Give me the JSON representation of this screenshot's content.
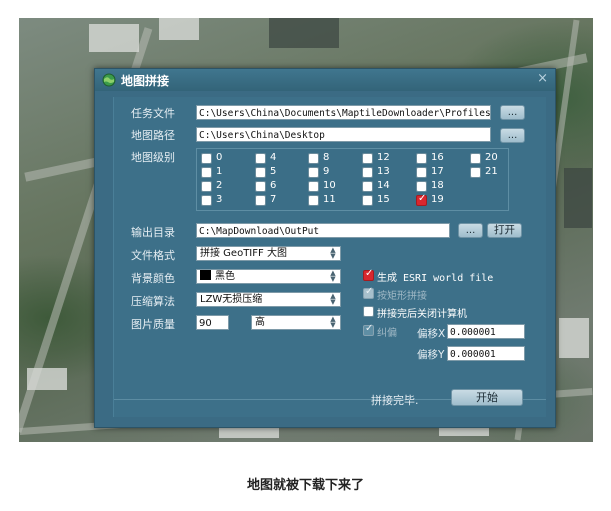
{
  "dialog": {
    "title": "地图拼接",
    "close_glyph": "×"
  },
  "task_file": {
    "label": "任务文件",
    "value": "C:\\Users\\China\\Documents\\MaptileDownloader\\Profiles\\",
    "browse_label": "..."
  },
  "map_path": {
    "label": "地图路径",
    "value": "C:\\Users\\China\\Desktop",
    "browse_label": "..."
  },
  "map_levels": {
    "label": "地图级别",
    "levels": [
      {
        "num": "0",
        "checked": false
      },
      {
        "num": "1",
        "checked": false
      },
      {
        "num": "2",
        "checked": false
      },
      {
        "num": "3",
        "checked": false
      },
      {
        "num": "4",
        "checked": false
      },
      {
        "num": "5",
        "checked": false
      },
      {
        "num": "6",
        "checked": false
      },
      {
        "num": "7",
        "checked": false
      },
      {
        "num": "8",
        "checked": false
      },
      {
        "num": "9",
        "checked": false
      },
      {
        "num": "10",
        "checked": false
      },
      {
        "num": "11",
        "checked": false
      },
      {
        "num": "12",
        "checked": false
      },
      {
        "num": "13",
        "checked": false
      },
      {
        "num": "14",
        "checked": false
      },
      {
        "num": "15",
        "checked": false
      },
      {
        "num": "16",
        "checked": false
      },
      {
        "num": "17",
        "checked": false
      },
      {
        "num": "18",
        "checked": false
      },
      {
        "num": "19",
        "checked": true
      },
      {
        "num": "20",
        "checked": false
      },
      {
        "num": "21",
        "checked": false
      }
    ]
  },
  "output_dir": {
    "label": "输出目录",
    "value": "C:\\MapDownload\\OutPut",
    "browse_label": "...",
    "open_label": "打开"
  },
  "file_format": {
    "label": "文件格式",
    "value": "拼接 GeoTIFF 大图"
  },
  "bg_color": {
    "label": "背景颜色",
    "value": "黑色",
    "swatch_color": "#000000"
  },
  "compression": {
    "label": "压缩算法",
    "value": "LZW无损压缩"
  },
  "quality": {
    "label": "图片质量",
    "value": "90",
    "level": "高"
  },
  "options": {
    "esri_world_file": {
      "label": "生成 ESRI world file",
      "checked": true
    },
    "rect_stitch": {
      "label": "按矩形拼接",
      "checked": true,
      "disabled": true
    },
    "shutdown": {
      "label": "拼接完后关闭计算机",
      "checked": false
    },
    "rectify": {
      "label": "纠偏",
      "checked": false,
      "disabled": true
    }
  },
  "offset_x": {
    "label": "偏移X",
    "value": "0.000001"
  },
  "offset_y": {
    "label": "偏移Y",
    "value": "0.000001"
  },
  "status_text": "拼接完毕.",
  "start_label": "开始",
  "caption": "地图就被下载下来了",
  "colors": {
    "dialog_bg": "#3d7089",
    "titlebar": "#336479",
    "check_red": "#d9272e"
  }
}
